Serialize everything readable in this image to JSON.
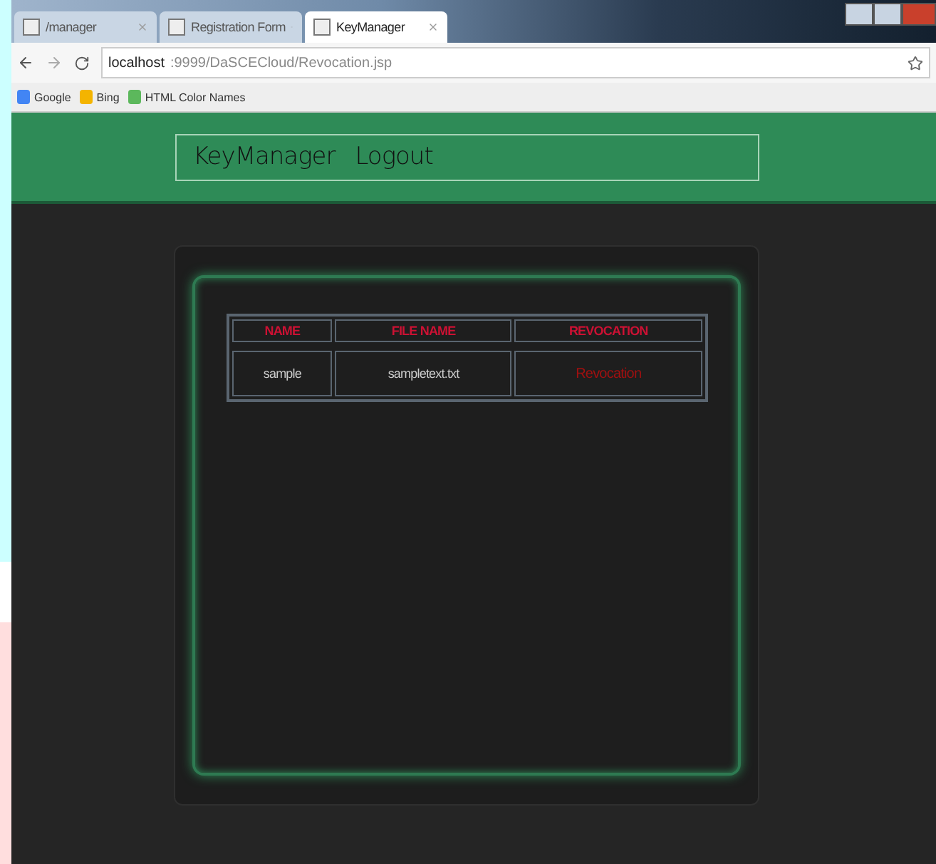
{
  "browser": {
    "tabs": [
      {
        "title": "/manager",
        "selected": false
      },
      {
        "title": "Registration Form",
        "selected": false
      },
      {
        "title": "KeyManager",
        "selected": true
      }
    ],
    "address": {
      "host": "localhost",
      "rest": ":9999/DaSCECloud/Revocation.jsp"
    },
    "bookmarks": [
      {
        "label": "Google",
        "kind": "google"
      },
      {
        "label": "Bing",
        "kind": "bing"
      },
      {
        "label": "HTML Color Names",
        "kind": "html"
      }
    ]
  },
  "nav": {
    "items": [
      "KeyManager",
      "Logout"
    ]
  },
  "table": {
    "columns": [
      "NAME",
      "FILE NAME",
      "REVOCATION"
    ],
    "rows": [
      {
        "cells": [
          "sample",
          "sampletext.txt"
        ],
        "action": "Revocation"
      }
    ]
  }
}
